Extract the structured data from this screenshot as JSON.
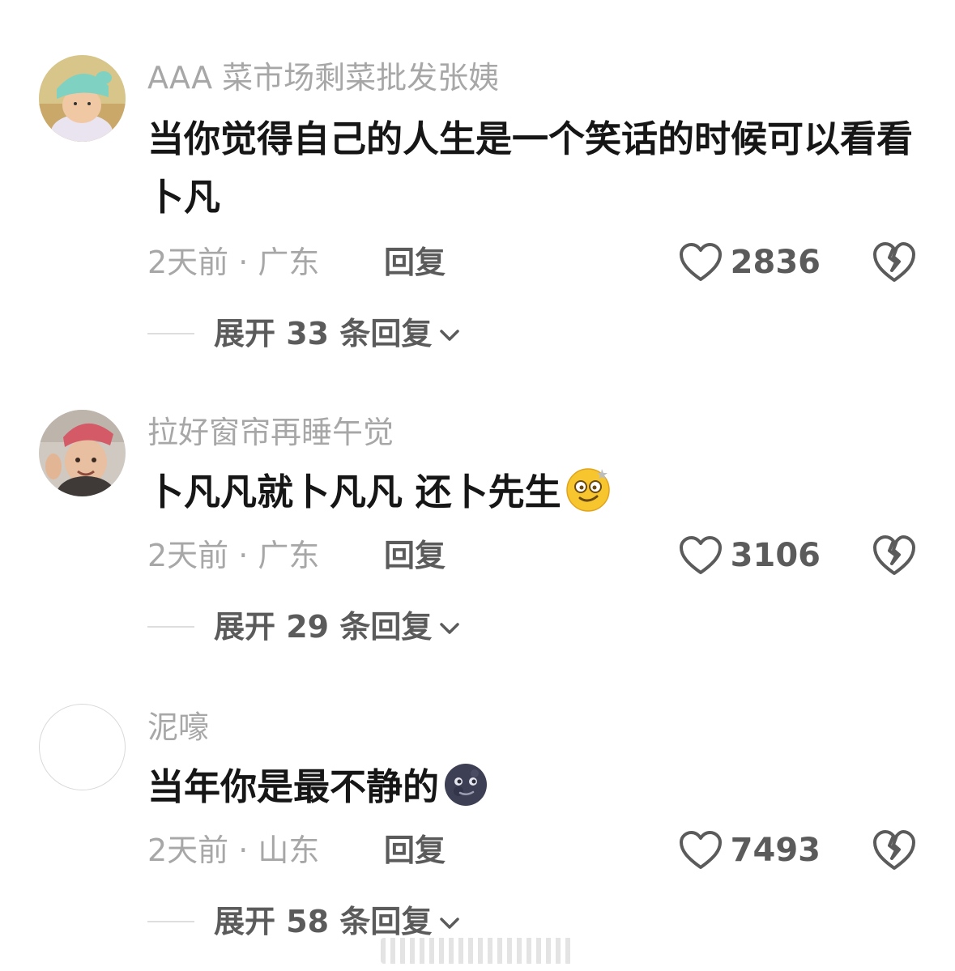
{
  "comments": [
    {
      "username": "AAA 菜市场剩菜批发张姨",
      "text": "当你觉得自己的人生是一个笑话的时候可以看看卜凡",
      "emoji": "",
      "time": "2天前 · 广东",
      "reply_label": "回复",
      "likes": "2836",
      "expand_label": "展开 33 条回复"
    },
    {
      "username": "拉好窗帘再睡午觉",
      "text": "卜凡凡就卜凡凡 还卜先生",
      "emoji": "dizzy-face-emoji",
      "time": "2天前 · 广东",
      "reply_label": "回复",
      "likes": "3106",
      "expand_label": "展开 29 条回复"
    },
    {
      "username": "泥嚎",
      "text": "当年你是最不静的",
      "emoji": "new-moon-face-emoji",
      "time": "2天前 · 山东",
      "reply_label": "回复",
      "likes": "7493",
      "expand_label": "展开 58 条回复"
    }
  ],
  "icons": {
    "like": "heart-outline-icon",
    "dislike": "broken-heart-icon",
    "expand": "chevron-down-icon"
  },
  "colors": {
    "text_primary": "#161616",
    "text_secondary": "#a7a7a7",
    "text_action": "#5b5b5b"
  }
}
